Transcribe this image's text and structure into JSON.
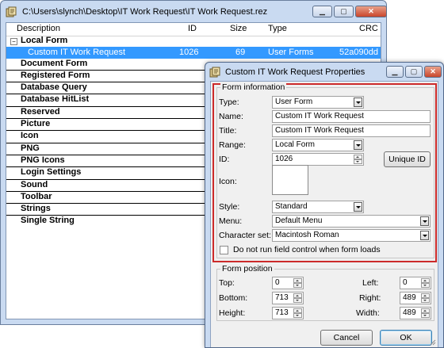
{
  "main_window": {
    "title": "C:\\Users\\slynch\\Desktop\\IT Work Request\\IT Work Request.rez",
    "columns": [
      "Description",
      "ID",
      "Size",
      "Type",
      "CRC"
    ],
    "expander_symbol": "⊟",
    "tree": [
      {
        "label": "Local Form",
        "expanded": true
      },
      {
        "label": "Custom IT Work Request",
        "id": "1026",
        "size": "69",
        "type": "User Forms",
        "crc": "52a090dd",
        "selected": true
      },
      {
        "label": "Document Form"
      },
      {
        "label": "Registered Form"
      },
      {
        "label": "Database Query"
      },
      {
        "label": "Database HitList"
      },
      {
        "label": "Reserved"
      },
      {
        "label": "Picture"
      },
      {
        "label": "Icon"
      },
      {
        "label": "PNG"
      },
      {
        "label": "PNG Icons"
      },
      {
        "label": "Login Settings"
      },
      {
        "label": "Sound"
      },
      {
        "label": "Toolbar"
      },
      {
        "label": "Strings"
      },
      {
        "label": "Single String"
      }
    ]
  },
  "dialog": {
    "title": "Custom IT Work Request Properties",
    "form_information": {
      "group_label": "Form information",
      "type_label": "Type:",
      "type_value": "User Form",
      "name_label": "Name:",
      "name_value": "Custom IT Work Request",
      "title_label": "Title:",
      "title_value": "Custom  IT Work Request",
      "range_label": "Range:",
      "range_value": "Local Form",
      "id_label": "ID:",
      "id_value": "1026",
      "unique_id_button": "Unique ID",
      "icon_label": "Icon:",
      "style_label": "Style:",
      "style_value": "Standard",
      "menu_label": "Menu:",
      "menu_value": "Default Menu",
      "charset_label": "Character set:",
      "charset_value": "Macintosh Roman",
      "no_field_control_label": "Do not run field control when form loads",
      "no_field_control_checked": false
    },
    "form_position": {
      "group_label": "Form position",
      "top_label": "Top:",
      "top_value": "0",
      "left_label": "Left:",
      "left_value": "0",
      "bottom_label": "Bottom:",
      "bottom_value": "713",
      "right_label": "Right:",
      "right_value": "489",
      "height_label": "Height:",
      "height_value": "713",
      "width_label": "Width:",
      "width_value": "489"
    },
    "cancel_button": "Cancel",
    "ok_button": "OK"
  },
  "colors": {
    "selection": "#3399ff",
    "highlight_border": "#cc2a2a",
    "window_frame": "#c9daf1"
  },
  "window_buttons": {
    "minimize": "minimize-icon",
    "maximize": "maximize-icon",
    "close": "close-icon"
  }
}
